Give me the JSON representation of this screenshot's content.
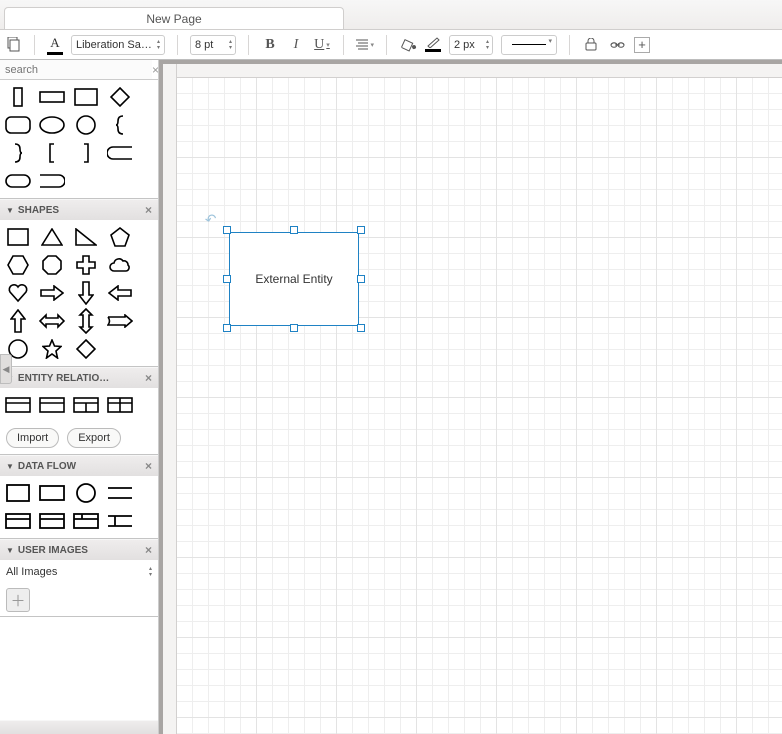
{
  "tab": {
    "title": "New Page"
  },
  "toolbar": {
    "font_family": "Liberation Sa…",
    "font_size": "8 pt",
    "bold_label": "B",
    "italic_label": "I",
    "underline_label": "U",
    "line_width": "2 px"
  },
  "search": {
    "placeholder": "search"
  },
  "sections": {
    "shapes": {
      "title": "SHAPES"
    },
    "entity": {
      "title": "ENTITY RELATIO…",
      "import_label": "Import",
      "export_label": "Export"
    },
    "dataflow": {
      "title": "DATA FLOW"
    },
    "userimages": {
      "title": "USER IMAGES",
      "all_images": "All Images"
    }
  },
  "canvas": {
    "selected_shape_label": "External Entity"
  }
}
